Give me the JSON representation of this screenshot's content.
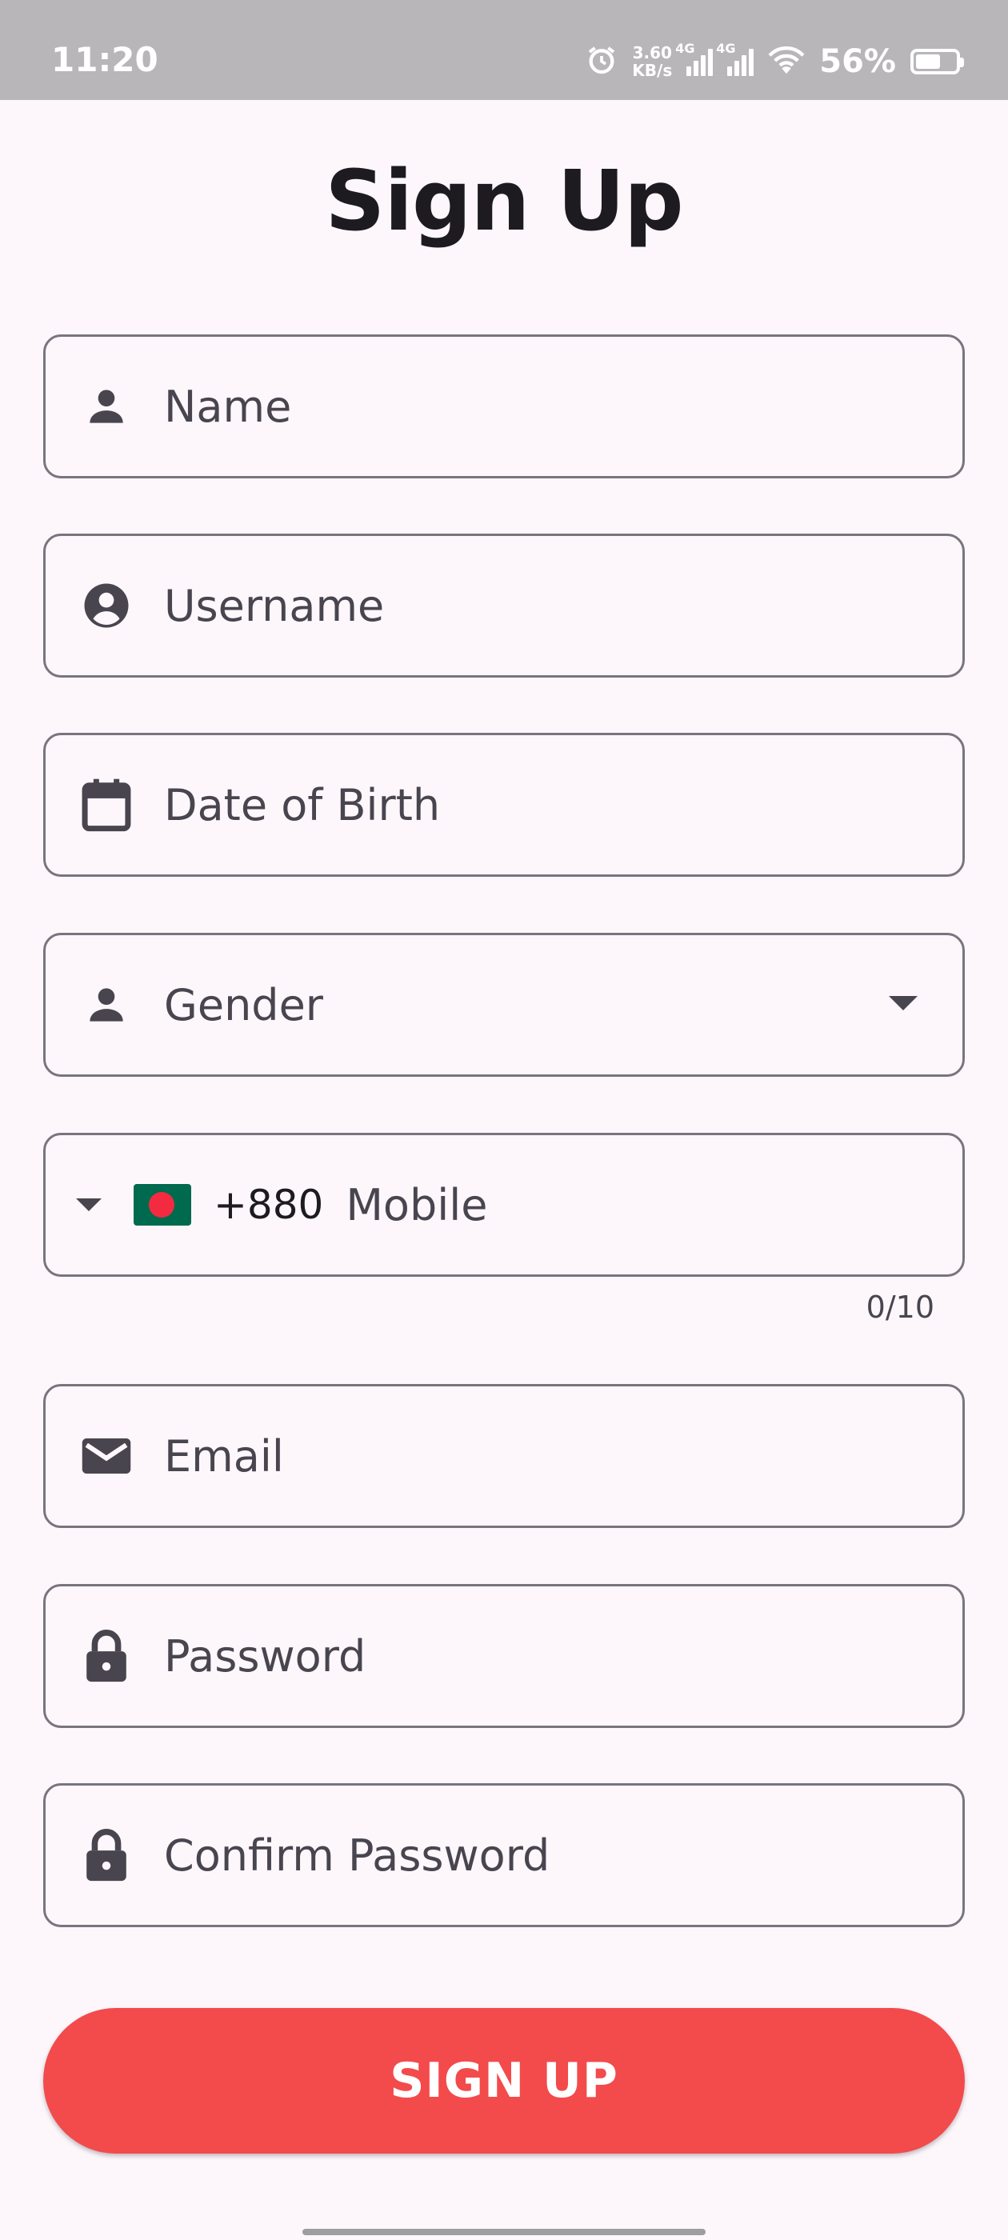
{
  "status_bar": {
    "time": "11:20",
    "net_speed_value": "3.60",
    "net_speed_unit": "KB/s",
    "network_label_1": "4G",
    "network_label_2": "4G",
    "battery_percent": "56%"
  },
  "page": {
    "title": "Sign Up"
  },
  "form": {
    "name_placeholder": "Name",
    "username_placeholder": "Username",
    "dob_placeholder": "Date of Birth",
    "gender_placeholder": "Gender",
    "phone_dial_code": "+880",
    "phone_placeholder": "Mobile",
    "phone_counter": "0/10",
    "email_placeholder": "Email",
    "password_placeholder": "Password",
    "confirm_password_placeholder": "Confirm Password",
    "submit_label": "SIGN UP"
  },
  "icons": {
    "name": "person-icon",
    "username": "account-circle-icon",
    "dob": "calendar-icon",
    "gender": "person-icon",
    "email": "mail-icon",
    "password": "lock-icon",
    "confirm_password": "lock-icon",
    "country_flag": "bangladesh-flag-icon"
  },
  "colors": {
    "accent": "#f34a4c",
    "outline": "#79747e",
    "background": "#fdf7fc"
  }
}
